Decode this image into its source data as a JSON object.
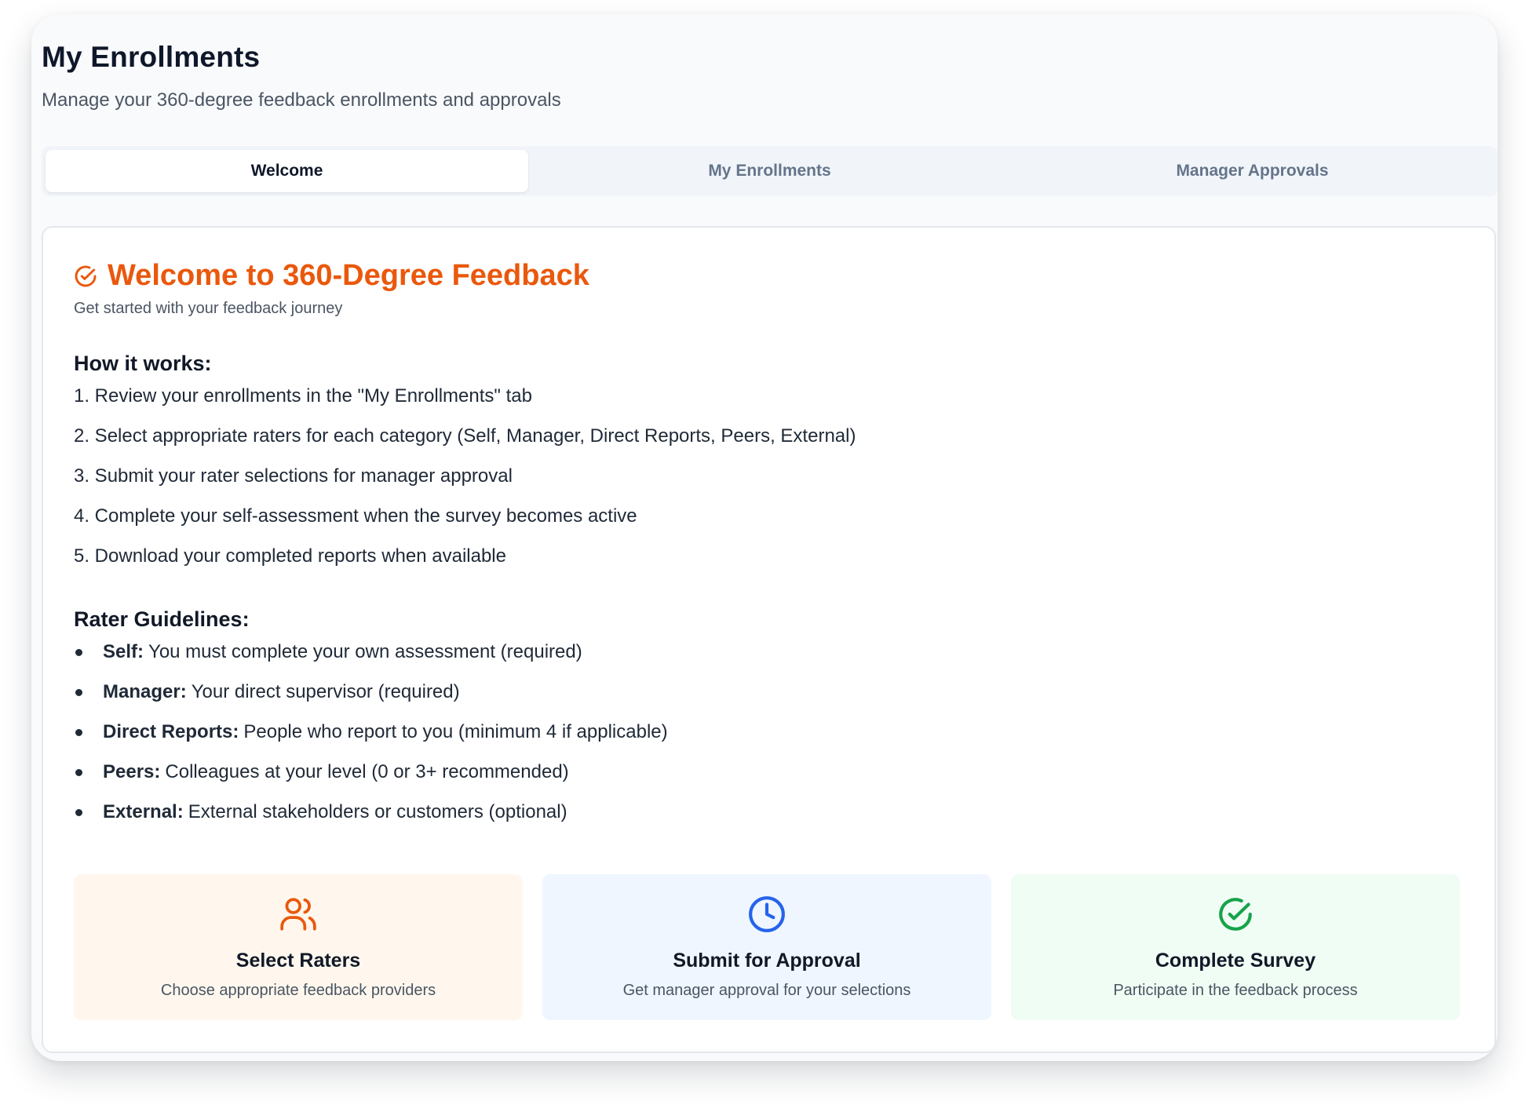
{
  "header": {
    "title": "My Enrollments",
    "subtitle": "Manage your 360-degree feedback enrollments and approvals"
  },
  "tabs": [
    {
      "label": "Welcome",
      "active": true
    },
    {
      "label": "My Enrollments",
      "active": false
    },
    {
      "label": "Manager Approvals",
      "active": false
    }
  ],
  "welcome": {
    "icon": "circle-check-icon",
    "title": "Welcome to 360-Degree Feedback",
    "subtitle": "Get started with your feedback journey",
    "how_heading": "How it works:",
    "steps": [
      "1. Review your enrollments in the \"My Enrollments\" tab",
      "2. Select appropriate raters for each category (Self, Manager, Direct Reports, Peers, External)",
      "3. Submit your rater selections for manager approval",
      "4. Complete your self-assessment when the survey becomes active",
      "5. Download your completed reports when available"
    ],
    "guidelines_heading": "Rater Guidelines:",
    "guidelines": [
      {
        "term": "Self:",
        "text": "You must complete your own assessment (required)"
      },
      {
        "term": "Manager:",
        "text": "Your direct supervisor (required)"
      },
      {
        "term": "Direct Reports:",
        "text": "People who report to you (minimum 4 if applicable)"
      },
      {
        "term": "Peers:",
        "text": "Colleagues at your level (0 or 3+ recommended)"
      },
      {
        "term": "External:",
        "text": "External stakeholders or customers (optional)"
      }
    ],
    "cards": [
      {
        "icon": "users-icon",
        "title": "Select Raters",
        "description": "Choose appropriate feedback providers",
        "color": "#ea580c",
        "bg": "#fff7ed"
      },
      {
        "icon": "clock-icon",
        "title": "Submit for Approval",
        "description": "Get manager approval for your selections",
        "color": "#2563eb",
        "bg": "#eff6ff"
      },
      {
        "icon": "circle-check-icon",
        "title": "Complete Survey",
        "description": "Participate in the feedback process",
        "color": "#16a34a",
        "bg": "#f0fdf4"
      }
    ]
  },
  "colors": {
    "accent": "#ea580c",
    "background": "#f8fafc"
  }
}
